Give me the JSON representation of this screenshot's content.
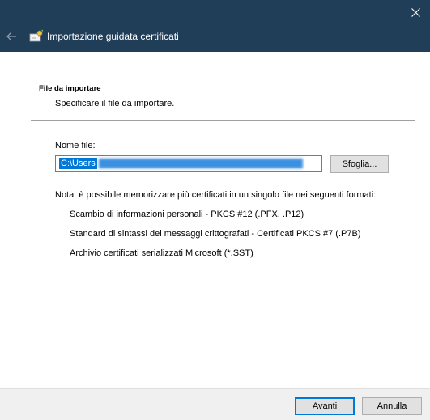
{
  "window": {
    "title": "Importazione guidata certificati",
    "icon": "certificate-wizard-icon",
    "close_icon": "close-icon",
    "back_icon": "back-arrow-icon",
    "titlebar_color": "#213e59"
  },
  "section": {
    "heading": "File da importare",
    "subheading": "Specificare il file da importare."
  },
  "file": {
    "label": "Nome file:",
    "value": "C:\\Users",
    "browse_label": "Sfoglia..."
  },
  "note": {
    "text": "Nota: è possibile memorizzare più certificati in un singolo file nei seguenti formati:",
    "formats": [
      "Scambio di informazioni personali - PKCS #12 (.PFX, .P12)",
      "Standard di sintassi dei messaggi crittografati - Certificati PKCS #7 (.P7B)",
      "Archivio certificati serializzati Microsoft (*.SST)"
    ]
  },
  "footer": {
    "next_label": "Avanti",
    "cancel_label": "Annulla",
    "accent_color": "#0078d7"
  }
}
